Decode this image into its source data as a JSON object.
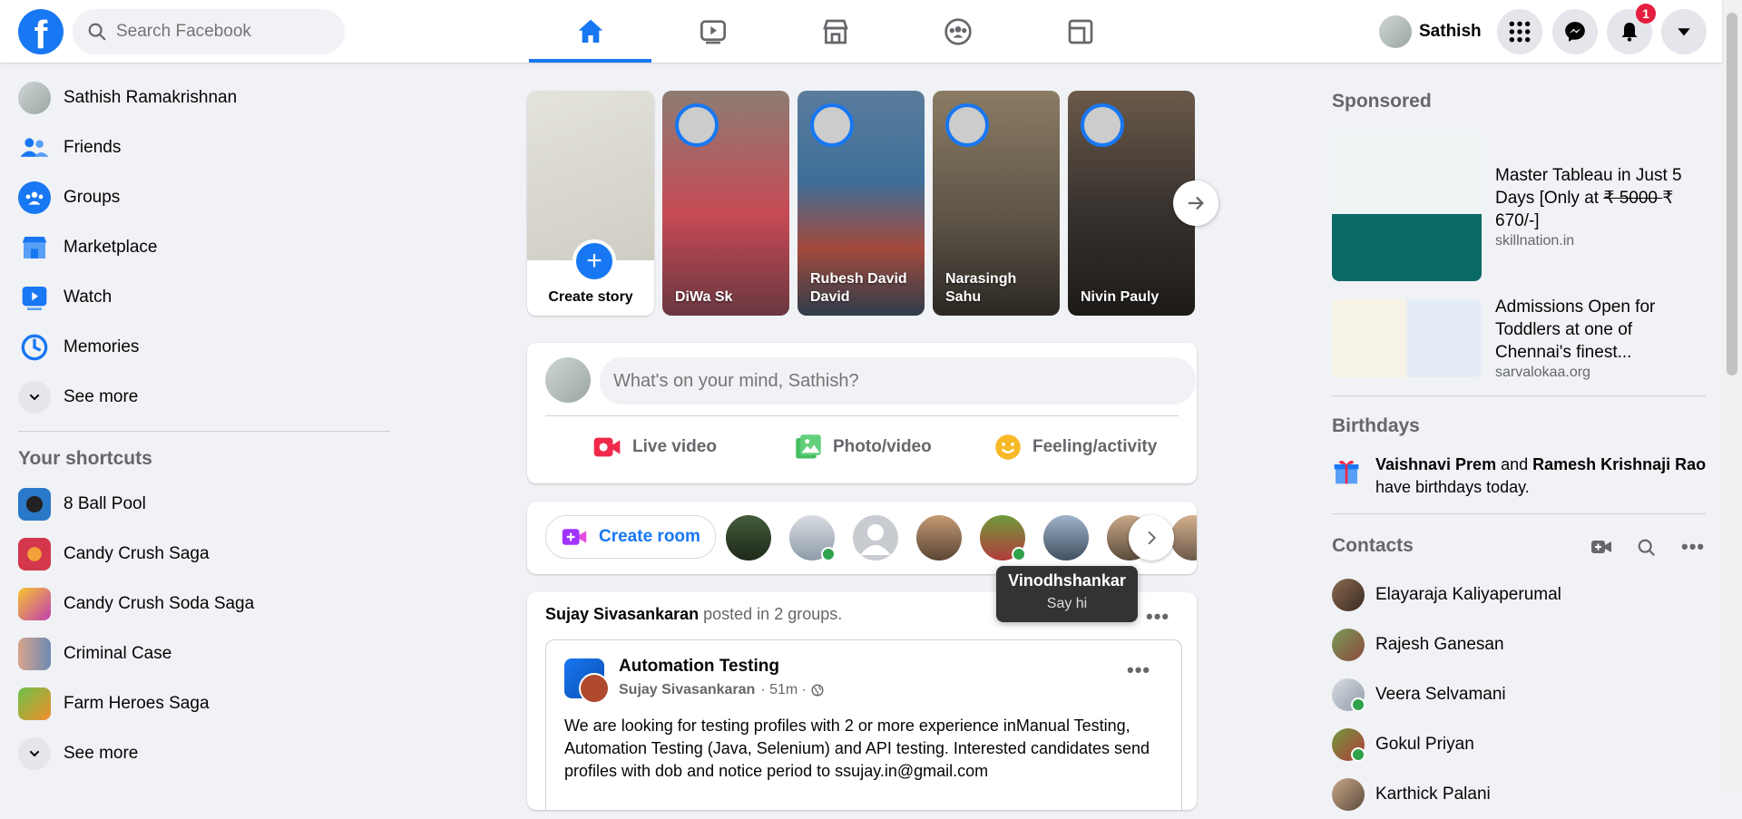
{
  "search": {
    "placeholder": "Search Facebook"
  },
  "profile": {
    "name": "Sathish"
  },
  "notifications": {
    "count": "1"
  },
  "left": {
    "user": "Sathish Ramakrishnan",
    "nav": [
      "Friends",
      "Groups",
      "Marketplace",
      "Watch",
      "Memories"
    ],
    "see_more": "See more",
    "shortcuts_title": "Your shortcuts",
    "shortcuts": [
      "8 Ball Pool",
      "Candy Crush Saga",
      "Candy Crush Soda Saga",
      "Criminal Case",
      "Farm Heroes Saga"
    ],
    "shortcuts_see_more": "See more"
  },
  "stories": {
    "create_label": "Create story",
    "items": [
      {
        "name": "DiWa Sk",
        "color": "#c64a55"
      },
      {
        "name": "Rubesh David David",
        "color": "#3e6f9a"
      },
      {
        "name": "Narasingh Sahu",
        "color": "#5b5246"
      },
      {
        "name": "Nivin Pauly",
        "color": "#3a3430"
      }
    ]
  },
  "composer": {
    "placeholder": "What's on your mind, Sathish?",
    "live": "Live video",
    "photo": "Photo/video",
    "feeling": "Feeling/activity"
  },
  "rooms": {
    "create": "Create room"
  },
  "tooltip": {
    "name": "Vinodhshankar",
    "action": "Say hi"
  },
  "post": {
    "author": "Sujay Sivasankaran",
    "posted_in": "posted in",
    "groups": "2 groups.",
    "group": "Automation Testing",
    "sub_author": "Sujay Sivasankaran",
    "time": "· 51m ·",
    "text": "We are looking for testing profiles with 2 or more experience inManual Testing, Automation Testing (Java, Selenium) and API testing. Interested candidates send profiles with dob and notice period to ssujay.in@gmail.com"
  },
  "right": {
    "sponsored": "Sponsored",
    "ads": [
      {
        "title_a": "Master Tableau in Just 5 Days [Only at ",
        "strike": "₹ 5000 ",
        "title_b": "₹ 670/-]",
        "site": "skillnation.in"
      },
      {
        "title": "Admissions Open for Toddlers at one of Chennai's finest...",
        "site": "sarvalokaa.org"
      }
    ],
    "birthdays_title": "Birthdays",
    "bday_name1": "Vaishnavi Prem",
    "bday_and": " and ",
    "bday_name2": "Ramesh Krishnaji Rao",
    "bday_rest": "have birthdays today.",
    "contacts_title": "Contacts",
    "contacts": [
      "Elayaraja Kaliyaperumal",
      "Rajesh Ganesan",
      "Veera Selvamani",
      "Gokul Priyan",
      "Karthick Palani"
    ]
  },
  "colors": {
    "brand": "#1877f2",
    "online": "#31a24c",
    "badge": "#e41e3f"
  }
}
